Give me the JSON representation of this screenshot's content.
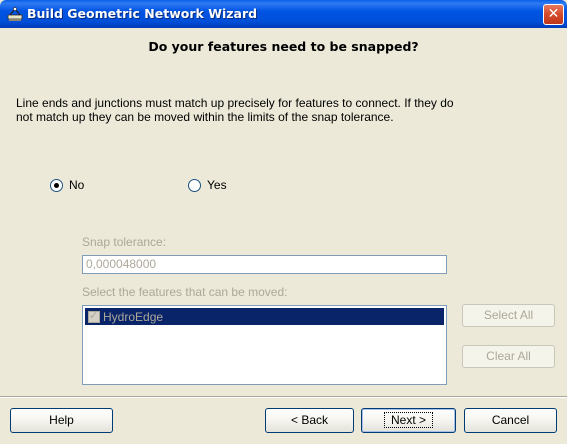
{
  "window": {
    "title": "Build Geometric Network Wizard",
    "close_label": "✕"
  },
  "page": {
    "heading": "Do your features need to be snapped?",
    "description": "Line ends and junctions must match up precisely for features to connect.  If they do not match up they can be moved within the limits of the snap tolerance."
  },
  "options": {
    "no_label": "No",
    "yes_label": "Yes",
    "selected": "No"
  },
  "snap": {
    "tolerance_label": "Snap tolerance:",
    "tolerance_value": "0,000048000",
    "features_label": "Select the features that can be moved:",
    "features": [
      {
        "label": "HydroEdge",
        "checked": true
      }
    ]
  },
  "side_buttons": {
    "select_all": "Select All",
    "clear_all": "Clear All"
  },
  "footer": {
    "help": "Help",
    "back": "< Back",
    "next": "Next >",
    "cancel": "Cancel"
  },
  "colors": {
    "titlebar": "#0054E3",
    "window_bg": "#ECE9D8",
    "selection": "#0A246A",
    "disabled_text": "#ACA899"
  }
}
